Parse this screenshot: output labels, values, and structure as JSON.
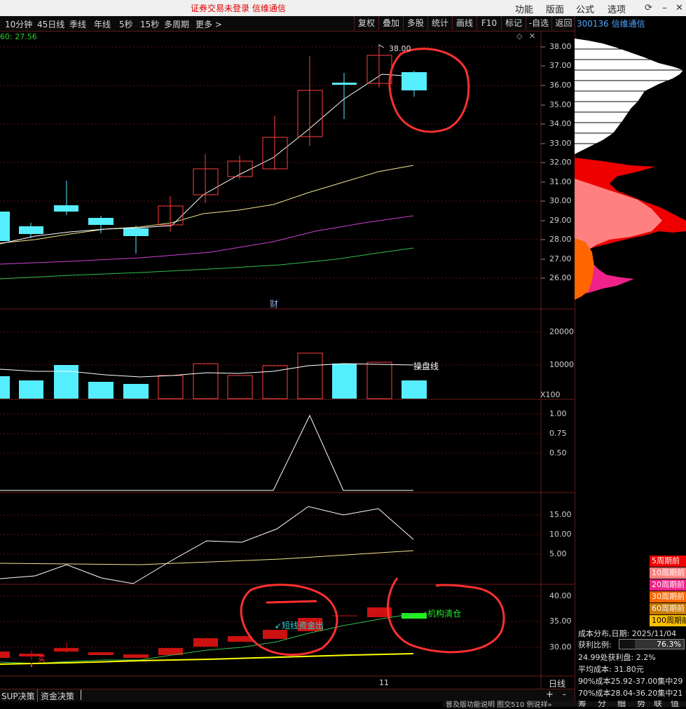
{
  "window": {
    "title": "证券交易未登录  信维通信",
    "menu": [
      "功能",
      "版面",
      "公式",
      "选项"
    ]
  },
  "toolbar": {
    "periods": [
      "10分钟",
      "45日线",
      "季线",
      "年线",
      "5秒",
      "15秒",
      "多周期",
      "更多 >"
    ],
    "right_buttons": [
      "复权",
      "叠加",
      "多股",
      "统计",
      "画线",
      "F10",
      "标记",
      "-自选",
      "返回"
    ]
  },
  "indicator_label": "60: 27.56",
  "price_axis": [
    "38.00",
    "37.00",
    "36.00",
    "35.00",
    "34.00",
    "33.00",
    "32.00",
    "31.00",
    "30.00",
    "29.00",
    "28.00",
    "27.00",
    "26.00"
  ],
  "high_marker": "38.00",
  "cai_hint": "财",
  "volume_axis": [
    "20000",
    "10000"
  ],
  "volume_unit": "X100",
  "volume_line_label": "操盘线",
  "ind2_axis": [
    "1.00",
    "0.75",
    "0.50"
  ],
  "ind3_axis": [
    "15.00",
    "10.00",
    "5.00"
  ],
  "ind4_axis": [
    "40.00",
    "35.00",
    "30.00"
  ],
  "ind4_labels": {
    "short_fund": "短线资金出",
    "inst_clear": "机构清仓",
    "buy": "买"
  },
  "date_label": "11",
  "period_label": "日线",
  "bottom_tabs": [
    "SUP决策",
    "资金决策"
  ],
  "zoom": {
    "plus": "+",
    "minus": "-"
  },
  "chip": {
    "stock_code": "300136",
    "stock_name": "信维通信",
    "legend": [
      {
        "label": "5周期前",
        "color": "#ee0000"
      },
      {
        "label": "10周期前",
        "color": "#ff8080"
      },
      {
        "label": "20周期前",
        "color": "#ee2288"
      },
      {
        "label": "30周期前",
        "color": "#ff6600"
      },
      {
        "label": "60周期前",
        "color": "#c87a00"
      },
      {
        "label": "100周期前",
        "color": "#ffc000"
      }
    ],
    "dist_date_label": "成本分布,日期:",
    "dist_date": "2025/11/04",
    "profit_ratio_label": "获利比例:",
    "profit_ratio": "76.3%",
    "profit_at": "24.99处获利盘:",
    "profit_at_value": "2.2%",
    "avg_cost_label": "平均成本:",
    "avg_cost": "31.80元",
    "cost90": "90%成本25.92-37.00集中29",
    "cost70": "70%成本28.04-36.20集中21",
    "bottom_tabs": [
      "筹",
      "分",
      "细",
      "势",
      "联",
      "值"
    ]
  },
  "footer": "普及版功能说明  图交510  例说祥»"
}
